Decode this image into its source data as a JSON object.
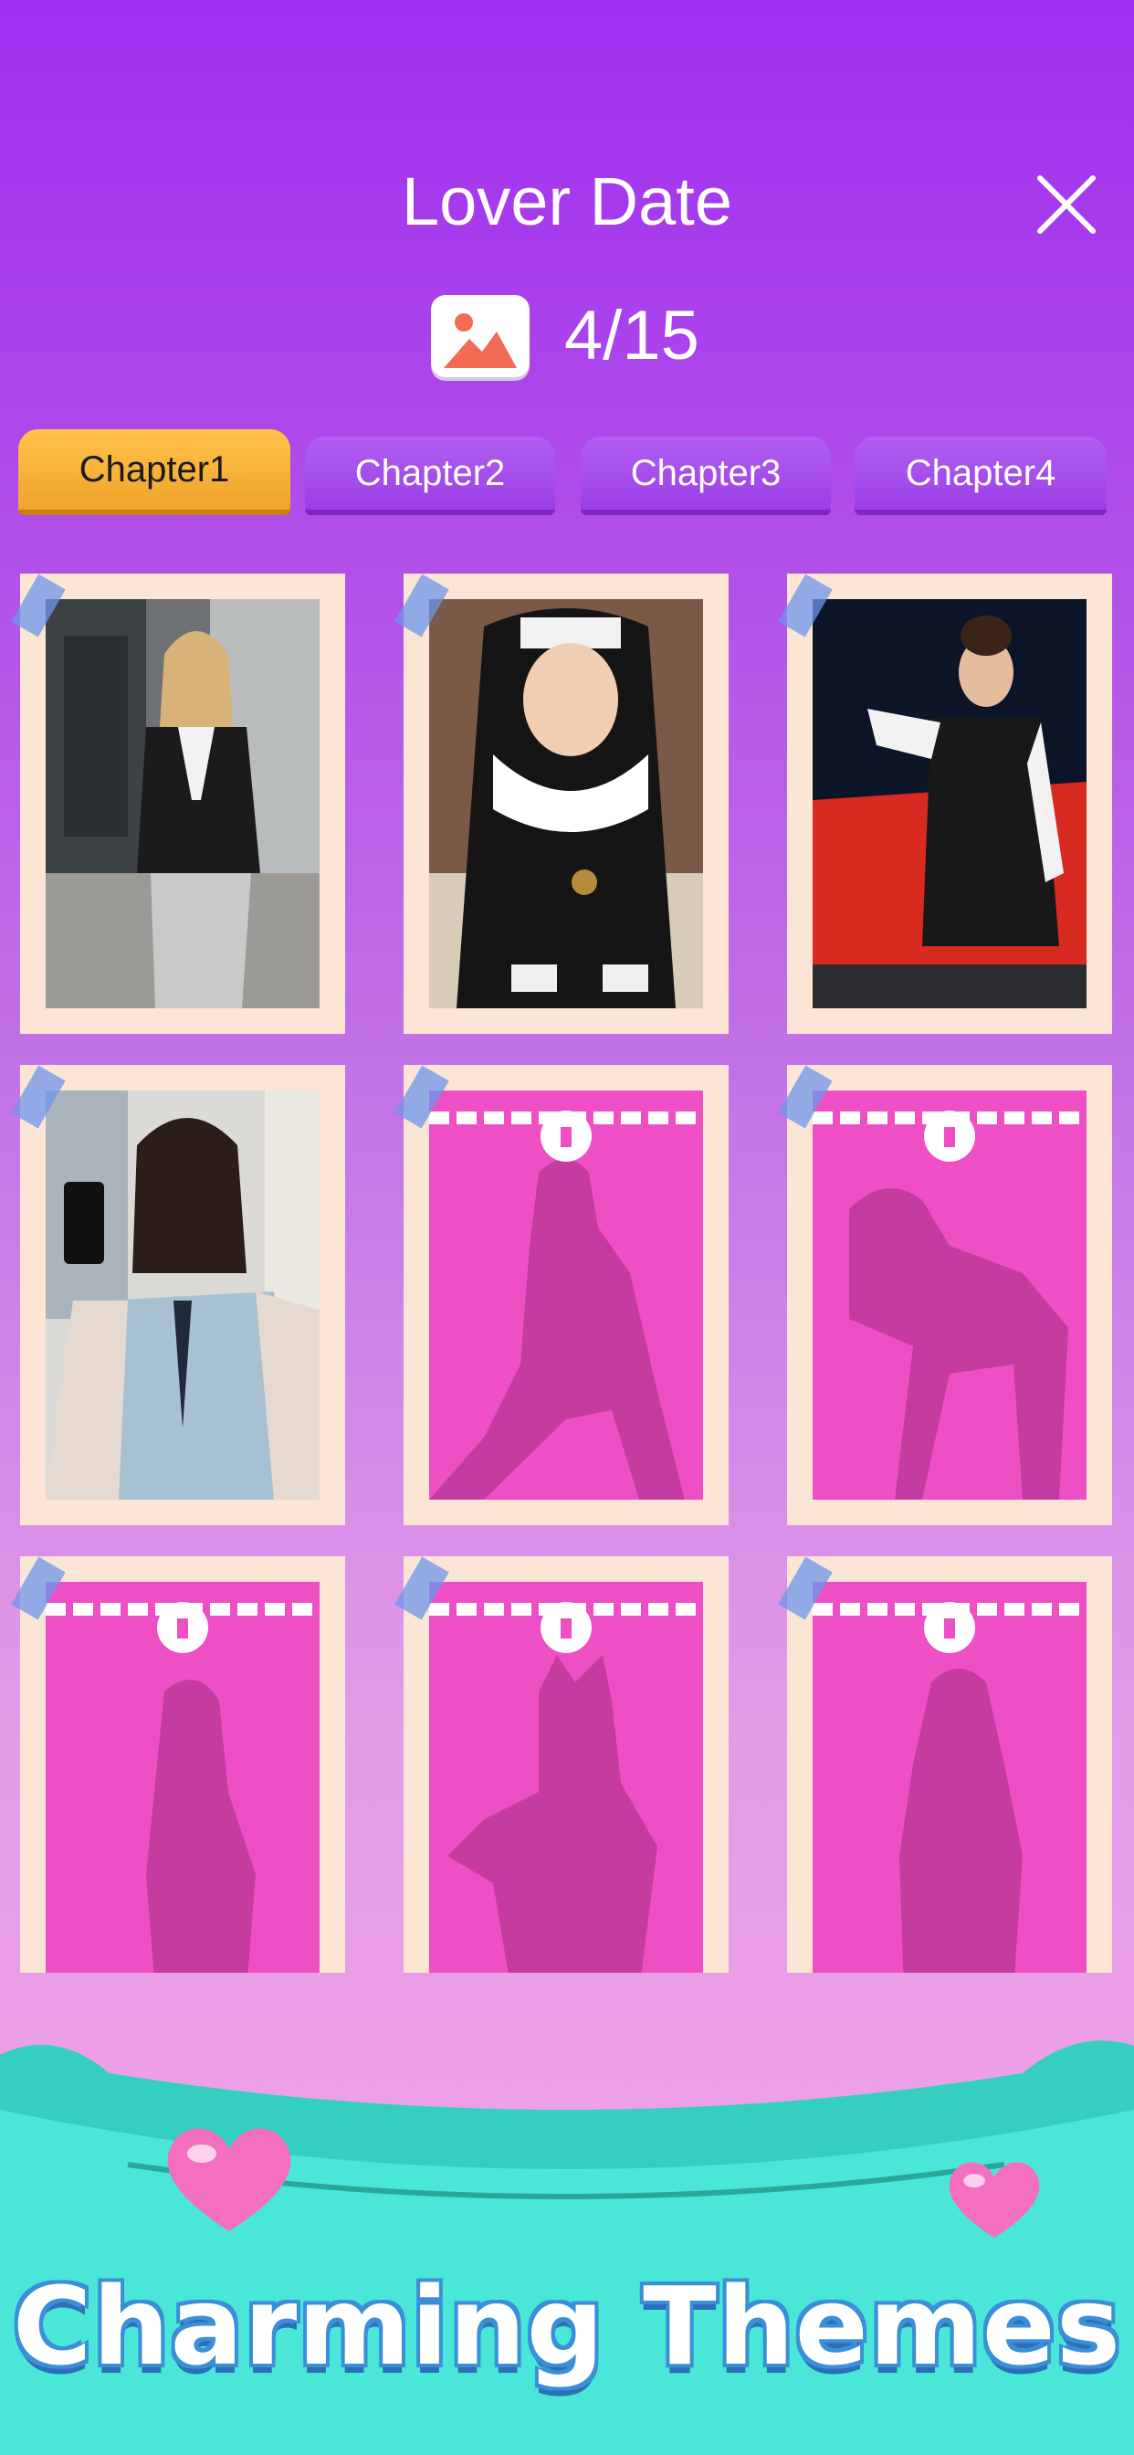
{
  "header": {
    "title": "Lover Date",
    "close_icon": "close-icon",
    "gallery_icon": "image-icon",
    "progress": "4/15"
  },
  "tabs": [
    {
      "label": "Chapter1",
      "active": true
    },
    {
      "label": "Chapter2",
      "active": false
    },
    {
      "label": "Chapter3",
      "active": false
    },
    {
      "label": "Chapter4",
      "active": false
    }
  ],
  "cards": [
    {
      "state": "unlocked",
      "subject": "woman in black blazer and grey skirt"
    },
    {
      "state": "unlocked",
      "subject": "woman in nun outfit"
    },
    {
      "state": "unlocked",
      "subject": "woman in black leather racing dress with red car"
    },
    {
      "state": "unlocked",
      "subject": "woman taking selfie in light blue shirt"
    },
    {
      "state": "locked",
      "subject": "silhouette"
    },
    {
      "state": "locked",
      "subject": "silhouette"
    },
    {
      "state": "locked",
      "subject": "silhouette"
    },
    {
      "state": "locked",
      "subject": "silhouette"
    },
    {
      "state": "locked",
      "subject": "silhouette"
    }
  ],
  "banner": {
    "text": "Charming Themes",
    "colors": {
      "ribbon": "#3fe3d3",
      "text_outline": "#3a8fd8"
    }
  },
  "colors": {
    "background_top": "#a02ef0",
    "background_bottom": "#f6a4e6",
    "active_tab": "#f0a42b",
    "locked_card": "#ef4fc4",
    "card_frame": "#fbe6d5"
  }
}
